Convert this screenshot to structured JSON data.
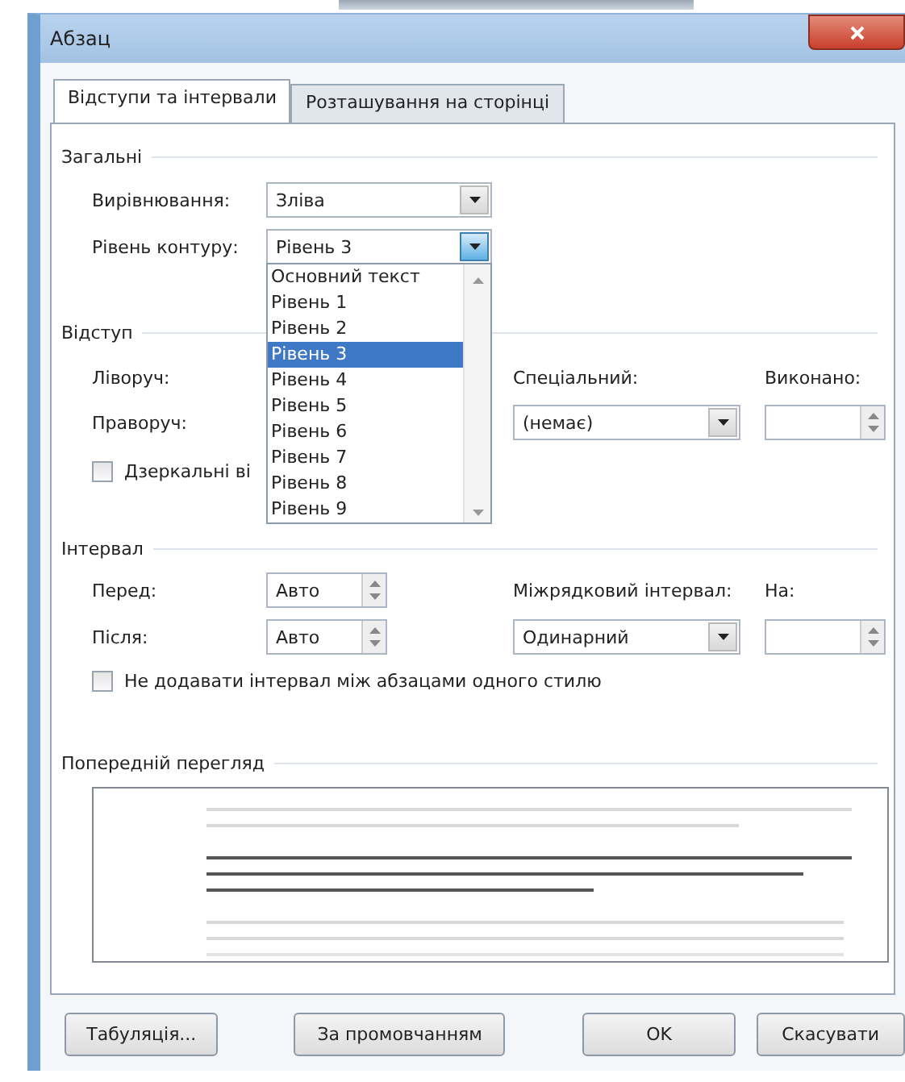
{
  "window": {
    "title": "Абзац"
  },
  "tabs": [
    {
      "label": "Відступи та інтервали",
      "selected": true
    },
    {
      "label": "Розташування на сторінці",
      "selected": false
    }
  ],
  "general": {
    "heading": "Загальні",
    "alignment": {
      "label": "Вирівнювання:",
      "value": "Зліва"
    },
    "outline_level": {
      "label": "Рівень контуру:",
      "value": "Рівень 3",
      "expanded": true
    }
  },
  "outline_dropdown": {
    "items": [
      {
        "label": "Основний текст",
        "selected": false
      },
      {
        "label": "Рівень 1",
        "selected": false
      },
      {
        "label": "Рівень 2",
        "selected": false
      },
      {
        "label": "Рівень 3",
        "selected": true
      },
      {
        "label": "Рівень 4",
        "selected": false
      },
      {
        "label": "Рівень 5",
        "selected": false
      },
      {
        "label": "Рівень 6",
        "selected": false
      },
      {
        "label": "Рівень 7",
        "selected": false
      },
      {
        "label": "Рівень 8",
        "selected": false
      },
      {
        "label": "Рівень 9",
        "selected": false
      }
    ]
  },
  "indentation": {
    "heading": "Відступ",
    "left": {
      "label": "Ліворуч:"
    },
    "right": {
      "label": "Праворуч:"
    },
    "special": {
      "label": "Спеціальний:",
      "value": "(немає)"
    },
    "by": {
      "label": "Виконано:"
    },
    "mirror": {
      "label": "Дзеркальні ві",
      "checked": false
    }
  },
  "spacing": {
    "heading": "Інтервал",
    "before": {
      "label": "Перед:",
      "value": "Авто"
    },
    "after": {
      "label": "Після:",
      "value": "Авто"
    },
    "line_spacing": {
      "label": "Міжрядковий інтервал:",
      "value": "Одинарний"
    },
    "at": {
      "label": "На:"
    },
    "dont_add": {
      "label": "Не додавати інтервал між абзацами одного стилю",
      "checked": false
    }
  },
  "preview": {
    "heading": "Попередній перегляд"
  },
  "buttons": [
    {
      "label": "Табуляція..."
    },
    {
      "label": "За промовчанням"
    },
    {
      "label": "OK"
    },
    {
      "label": "Скасувати"
    }
  ]
}
